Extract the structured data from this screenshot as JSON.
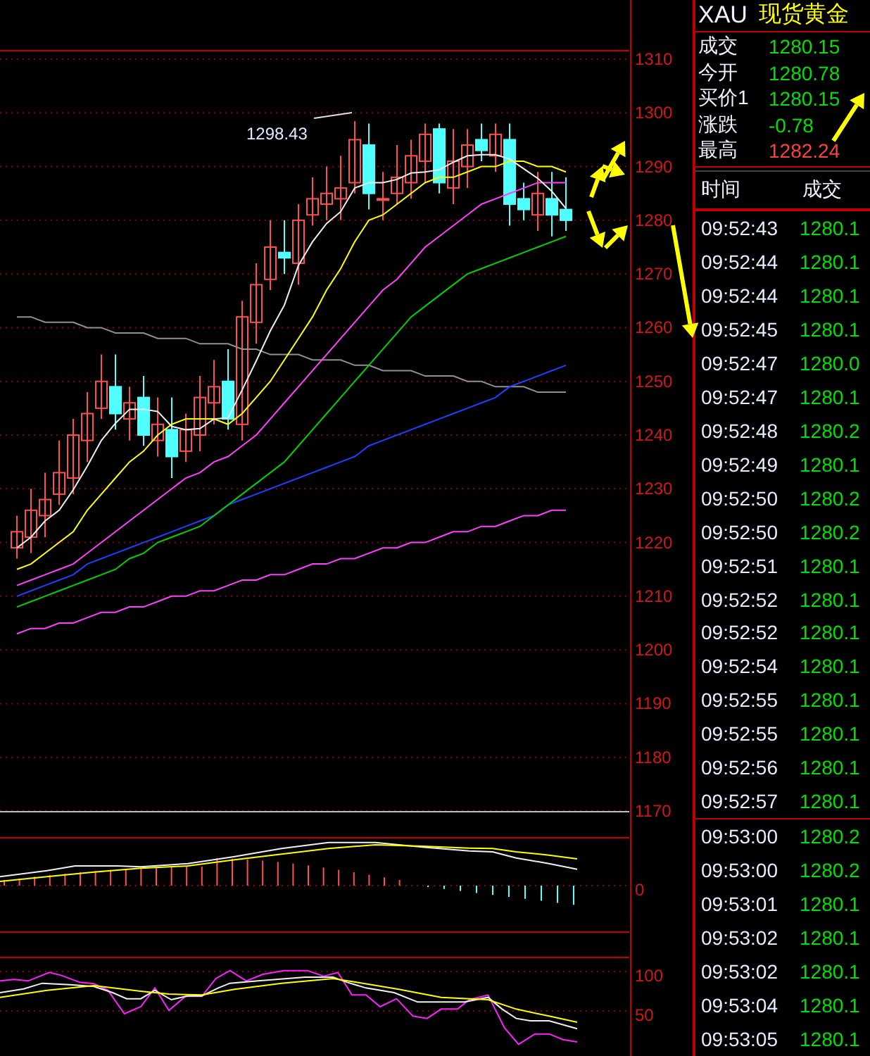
{
  "chart": {
    "high_label": "1298.43",
    "chart_data": {
      "type": "candlestick",
      "grid": true,
      "ylim": [
        1170,
        1310
      ],
      "yticks": [
        1310,
        1300,
        1290,
        1280,
        1270,
        1260,
        1250,
        1240,
        1230,
        1220,
        1210,
        1200,
        1190,
        1180,
        1170
      ],
      "ohlc": [
        [
          1219,
          1225,
          1217,
          1222
        ],
        [
          1221,
          1230,
          1218,
          1226
        ],
        [
          1225,
          1233,
          1221,
          1228
        ],
        [
          1229,
          1239,
          1227,
          1233
        ],
        [
          1232,
          1243,
          1229,
          1240
        ],
        [
          1239,
          1248,
          1235,
          1244
        ],
        [
          1245,
          1255,
          1243,
          1250
        ],
        [
          1249,
          1255,
          1241,
          1244
        ],
        [
          1243,
          1249,
          1239,
          1246
        ],
        [
          1247,
          1251,
          1238,
          1240
        ],
        [
          1239,
          1247,
          1236,
          1242
        ],
        [
          1241,
          1247,
          1232,
          1236
        ],
        [
          1237,
          1244,
          1235,
          1241
        ],
        [
          1240,
          1251,
          1237,
          1247
        ],
        [
          1246,
          1254,
          1242,
          1249
        ],
        [
          1250,
          1256,
          1241,
          1243
        ],
        [
          1242,
          1265,
          1239,
          1262
        ],
        [
          1261,
          1272,
          1257,
          1268
        ],
        [
          1269,
          1280,
          1267,
          1275
        ],
        [
          1274,
          1280,
          1270,
          1273
        ],
        [
          1272,
          1283,
          1268,
          1280
        ],
        [
          1281,
          1288,
          1279,
          1284
        ],
        [
          1283,
          1290,
          1280,
          1285
        ],
        [
          1284,
          1292,
          1280,
          1286
        ],
        [
          1287,
          1298.43,
          1285,
          1295
        ],
        [
          1294,
          1298,
          1282,
          1285
        ],
        [
          1284,
          1289,
          1280,
          1284
        ],
        [
          1285,
          1294,
          1283,
          1288
        ],
        [
          1287,
          1295,
          1284,
          1292
        ],
        [
          1291,
          1298,
          1287,
          1296
        ],
        [
          1297,
          1298,
          1285,
          1287
        ],
        [
          1286,
          1297,
          1283,
          1291
        ],
        [
          1290,
          1297,
          1286,
          1294
        ],
        [
          1295,
          1298,
          1291,
          1293
        ],
        [
          1292,
          1298,
          1289,
          1296
        ],
        [
          1295,
          1298,
          1279,
          1283
        ],
        [
          1284,
          1287,
          1280,
          1282
        ],
        [
          1281,
          1289,
          1278,
          1285
        ],
        [
          1284,
          1289,
          1277,
          1281
        ],
        [
          1282,
          1288,
          1278,
          1280
        ]
      ],
      "series": [
        {
          "type": "line",
          "color": "#909090",
          "values": [
            1262,
            1262,
            1261,
            1261,
            1261,
            1260,
            1260,
            1259,
            1259,
            1259,
            1258,
            1258,
            1258,
            1257,
            1257,
            1257,
            1256,
            1256,
            1255,
            1255,
            1255,
            1254,
            1254,
            1254,
            1253,
            1253,
            1252,
            1252,
            1252,
            1251,
            1251,
            1251,
            1250,
            1250,
            1249,
            1249,
            1249,
            1248,
            1248,
            1248
          ]
        },
        {
          "type": "line",
          "color": "#ff40ff",
          "values": [
            1203,
            1204,
            1204,
            1205,
            1205,
            1206,
            1207,
            1207,
            1208,
            1208,
            1209,
            1210,
            1210,
            1211,
            1211,
            1212,
            1213,
            1213,
            1214,
            1214,
            1215,
            1216,
            1216,
            1217,
            1217,
            1218,
            1219,
            1219,
            1220,
            1220,
            1221,
            1222,
            1222,
            1223,
            1223,
            1224,
            1225,
            1225,
            1226,
            1226
          ]
        },
        {
          "type": "line",
          "color": "#2040ff",
          "values": [
            1210,
            1211,
            1212,
            1213,
            1214,
            1216,
            1217,
            1218,
            1219,
            1220,
            1221,
            1222,
            1223,
            1224,
            1225,
            1227,
            1228,
            1229,
            1230,
            1231,
            1232,
            1233,
            1234,
            1235,
            1236,
            1238,
            1239,
            1240,
            1241,
            1242,
            1243,
            1244,
            1245,
            1246,
            1247,
            1249,
            1250,
            1251,
            1252,
            1253
          ]
        },
        {
          "type": "line",
          "color": "#00d000",
          "values": [
            1208,
            1209,
            1210,
            1211,
            1212,
            1213,
            1214,
            1215,
            1217,
            1218,
            1220,
            1221,
            1222,
            1223,
            1225,
            1227,
            1229,
            1231,
            1233,
            1235,
            1238,
            1241,
            1244,
            1247,
            1250,
            1253,
            1256,
            1259,
            1262,
            1264,
            1266,
            1268,
            1270,
            1271,
            1272,
            1273,
            1274,
            1275,
            1276,
            1277
          ]
        },
        {
          "type": "line",
          "color": "#ff40ff",
          "values": [
            1212,
            1213,
            1214,
            1215,
            1216,
            1218,
            1220,
            1222,
            1224,
            1226,
            1228,
            1230,
            1232,
            1233,
            1235,
            1236,
            1238,
            1240,
            1243,
            1246,
            1249,
            1252,
            1255,
            1258,
            1261,
            1264,
            1267,
            1269,
            1272,
            1275,
            1277,
            1279,
            1281,
            1283,
            1284,
            1285,
            1286,
            1287,
            1287,
            1287
          ]
        },
        {
          "type": "line",
          "color": "#ffff00",
          "values": [
            1215,
            1216,
            1218,
            1220,
            1222,
            1226,
            1229,
            1232,
            1235,
            1237,
            1240,
            1242,
            1243,
            1243,
            1243,
            1242,
            1244,
            1247,
            1250,
            1254,
            1258,
            1262,
            1267,
            1271,
            1276,
            1280,
            1281,
            1283,
            1285,
            1287,
            1288,
            1288,
            1289,
            1290,
            1290,
            1291,
            1291,
            1290,
            1290,
            1289
          ]
        },
        {
          "type": "line",
          "color": "#f0f0f0",
          "values": [
            1219,
            1221,
            1224,
            1226,
            1229.8,
            1234.2,
            1239,
            1242.2,
            1244.8,
            1244.8,
            1244.4,
            1241.6,
            1241,
            1241.2,
            1243,
            1243.2,
            1248.4,
            1253.8,
            1259.4,
            1264.2,
            1271.6,
            1276,
            1279.4,
            1281.6,
            1286,
            1287,
            1287,
            1287.6,
            1288.8,
            1289,
            1289.4,
            1290.8,
            1292,
            1292.2,
            1292.2,
            1291.4,
            1289.6,
            1287.8,
            1285.4,
            1282.2
          ]
        }
      ]
    }
  },
  "macd": {
    "axis_labels": [
      "0"
    ]
  },
  "kdj": {
    "axis_labels": [
      "100",
      "50"
    ]
  },
  "header": {
    "symbol": "XAU",
    "name": "现货黄金"
  },
  "quote": [
    {
      "label": "成交",
      "value": "1280.15",
      "color": "#00e000"
    },
    {
      "label": "今开",
      "value": "1280.78",
      "color": "#00e000"
    },
    {
      "label": "买价1",
      "value": "1280.15",
      "color": "#00e000"
    },
    {
      "label": "涨跌",
      "value": "-0.78",
      "color": "#00e000"
    },
    {
      "label": "最高",
      "value": "1282.24",
      "color": "#ff4040"
    }
  ],
  "ticks_header": {
    "time": "时间",
    "price": "成交"
  },
  "ticks": [
    {
      "time": "09:52:43",
      "price": "1280.1"
    },
    {
      "time": "09:52:44",
      "price": "1280.1"
    },
    {
      "time": "09:52:44",
      "price": "1280.1"
    },
    {
      "time": "09:52:45",
      "price": "1280.1"
    },
    {
      "time": "09:52:47",
      "price": "1280.0"
    },
    {
      "time": "09:52:47",
      "price": "1280.1"
    },
    {
      "time": "09:52:48",
      "price": "1280.2"
    },
    {
      "time": "09:52:49",
      "price": "1280.1"
    },
    {
      "time": "09:52:50",
      "price": "1280.2"
    },
    {
      "time": "09:52:50",
      "price": "1280.2"
    },
    {
      "time": "09:52:51",
      "price": "1280.1"
    },
    {
      "time": "09:52:52",
      "price": "1280.1"
    },
    {
      "time": "09:52:52",
      "price": "1280.1"
    },
    {
      "time": "09:52:54",
      "price": "1280.1"
    },
    {
      "time": "09:52:55",
      "price": "1280.1"
    },
    {
      "time": "09:52:55",
      "price": "1280.1"
    },
    {
      "time": "09:52:56",
      "price": "1280.1"
    },
    {
      "time": "09:52:57",
      "price": "1280.1"
    },
    {
      "time": "09:53:00",
      "price": "1280.2"
    },
    {
      "time": "09:53:00",
      "price": "1280.2"
    },
    {
      "time": "09:53:01",
      "price": "1280.1"
    },
    {
      "time": "09:53:02",
      "price": "1280.1"
    },
    {
      "time": "09:53:02",
      "price": "1280.1"
    },
    {
      "time": "09:53:04",
      "price": "1280.1"
    },
    {
      "time": "09:53:05",
      "price": "1280.1"
    }
  ]
}
